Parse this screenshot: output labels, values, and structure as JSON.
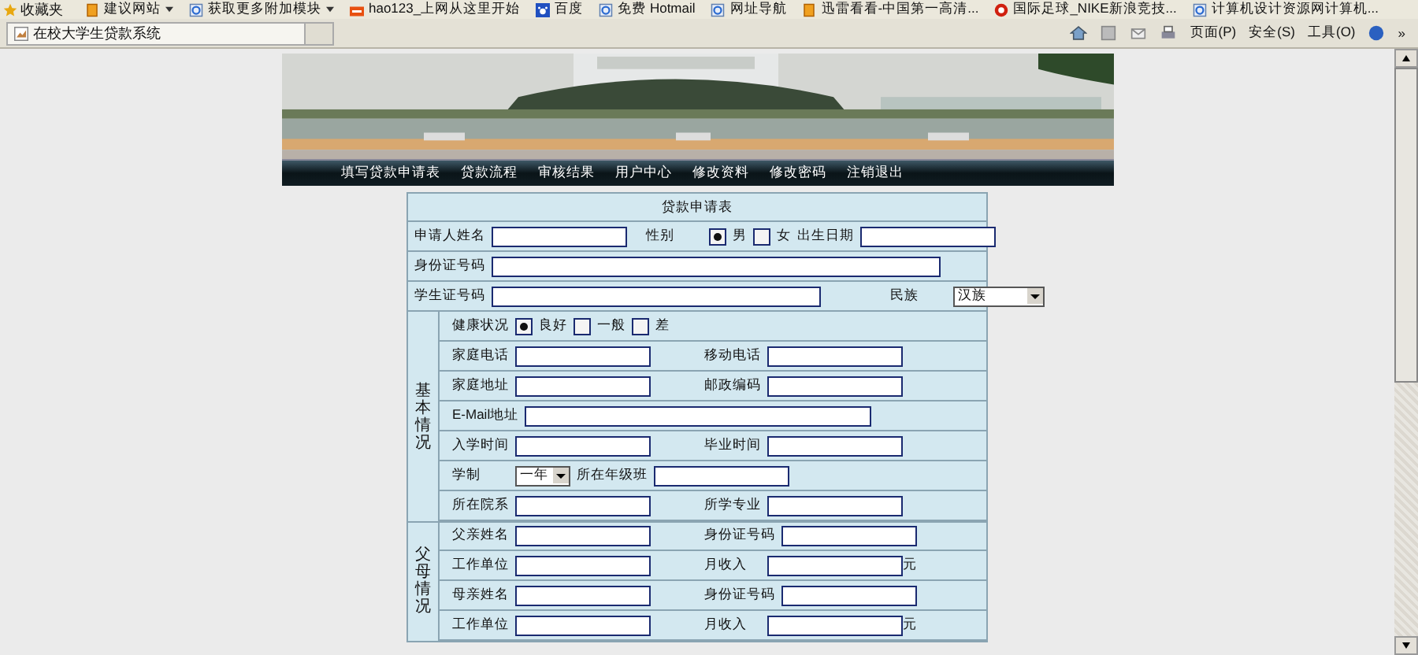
{
  "favorites_bar": {
    "label": "收藏夹",
    "items": [
      {
        "label": "建议网站",
        "dropdown": true
      },
      {
        "label": "获取更多附加模块",
        "dropdown": true
      },
      {
        "label": "hao123_上网从这里开始",
        "dropdown": false
      },
      {
        "label": "百度",
        "dropdown": false
      },
      {
        "label": "免费 Hotmail",
        "dropdown": false
      },
      {
        "label": "网址导航",
        "dropdown": false
      },
      {
        "label": "迅雷看看-中国第一高清...",
        "dropdown": false
      },
      {
        "label": "国际足球_NIKE新浪竞技...",
        "dropdown": false
      },
      {
        "label": "计算机设计资源网计算机...",
        "dropdown": false
      }
    ]
  },
  "tab": {
    "title": "在校大学生贷款系统"
  },
  "command_bar": {
    "menus": [
      "页面(P)",
      "安全(S)",
      "工具(O)"
    ],
    "more": "»"
  },
  "banner": {
    "nav": [
      "填写贷款申请表",
      "贷款流程",
      "审核结果",
      "用户中心",
      "修改资料",
      "修改密码",
      "注销退出"
    ]
  },
  "form": {
    "title": "贷款申请表",
    "rows": [
      {
        "items": [
          {
            "kind": "label",
            "text": "申请人姓名"
          },
          {
            "kind": "field"
          },
          {
            "kind": "label",
            "text": "性别"
          },
          {
            "kind": "radio",
            "label": "男",
            "selected": true
          },
          {
            "kind": "radio",
            "label": "女",
            "selected": false
          },
          {
            "kind": "label",
            "text": "出生日期"
          },
          {
            "kind": "field"
          }
        ]
      },
      {
        "items": [
          {
            "kind": "label",
            "text": "身份证号码"
          },
          {
            "kind": "long_field"
          }
        ]
      },
      {
        "items": [
          {
            "kind": "label",
            "text": "学生证号码"
          },
          {
            "kind": "mid_field"
          },
          {
            "kind": "label",
            "text": "民族"
          },
          {
            "kind": "select",
            "value": "汉族"
          }
        ]
      }
    ],
    "sections": [
      {
        "label": "基本情况",
        "rows": [
          {
            "items": [
              {
                "kind": "label",
                "text": "健康状况"
              },
              {
                "kind": "radio",
                "label": "良好",
                "selected": true
              },
              {
                "kind": "radio",
                "label": "一般",
                "selected": false
              },
              {
                "kind": "radio",
                "label": "差",
                "selected": false
              }
            ]
          },
          {
            "items": [
              {
                "kind": "label",
                "text": "家庭电话"
              },
              {
                "kind": "field"
              },
              {
                "kind": "label",
                "text": "移动电话"
              },
              {
                "kind": "field"
              }
            ]
          },
          {
            "items": [
              {
                "kind": "label",
                "text": "家庭地址"
              },
              {
                "kind": "field"
              },
              {
                "kind": "label",
                "text": "邮政编码"
              },
              {
                "kind": "field"
              }
            ]
          },
          {
            "items": [
              {
                "kind": "label",
                "text": "E-Mail地址"
              },
              {
                "kind": "long_field"
              }
            ]
          },
          {
            "items": [
              {
                "kind": "label",
                "text": "入学时间"
              },
              {
                "kind": "field"
              },
              {
                "kind": "label",
                "text": "毕业时间"
              },
              {
                "kind": "field"
              }
            ]
          },
          {
            "items": [
              {
                "kind": "label",
                "text": "学制"
              },
              {
                "kind": "select",
                "value": "一年"
              },
              {
                "kind": "label",
                "text": "所在年级班"
              },
              {
                "kind": "field"
              }
            ]
          },
          {
            "items": [
              {
                "kind": "label",
                "text": "所在院系"
              },
              {
                "kind": "field"
              },
              {
                "kind": "label",
                "text": "所学专业"
              },
              {
                "kind": "field"
              }
            ]
          }
        ]
      },
      {
        "label": "父母情况",
        "rows": [
          {
            "items": [
              {
                "kind": "label",
                "text": "父亲姓名"
              },
              {
                "kind": "field"
              },
              {
                "kind": "label",
                "text": "身份证号码"
              },
              {
                "kind": "field"
              }
            ]
          },
          {
            "items": [
              {
                "kind": "label",
                "text": "工作单位"
              },
              {
                "kind": "field"
              },
              {
                "kind": "label",
                "text": "月收入"
              },
              {
                "kind": "field"
              },
              {
                "kind": "unit",
                "text": "元"
              }
            ]
          },
          {
            "items": [
              {
                "kind": "label",
                "text": "母亲姓名"
              },
              {
                "kind": "field"
              },
              {
                "kind": "label",
                "text": "身份证号码"
              },
              {
                "kind": "field"
              }
            ]
          },
          {
            "items": [
              {
                "kind": "label",
                "text": "工作单位"
              },
              {
                "kind": "field"
              },
              {
                "kind": "label",
                "text": "月收入"
              },
              {
                "kind": "field"
              },
              {
                "kind": "unit",
                "text": "元"
              }
            ]
          }
        ]
      }
    ]
  }
}
